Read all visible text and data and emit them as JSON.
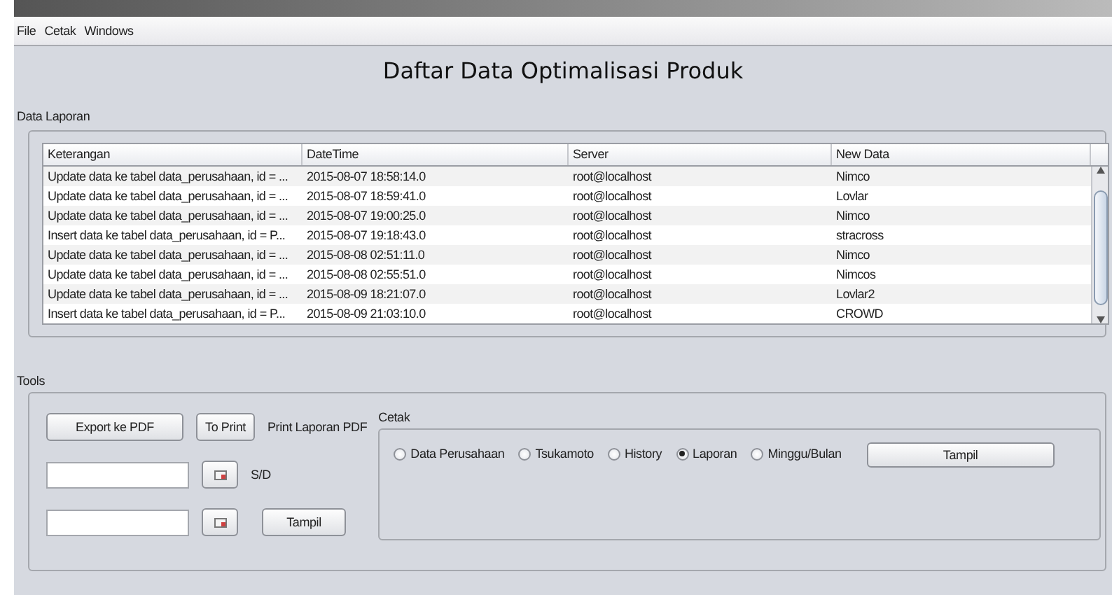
{
  "menu": [
    "File",
    "Cetak",
    "Windows"
  ],
  "title": "Daftar Data Optimalisasi Produk",
  "report_panel": {
    "label": "Data Laporan",
    "table": {
      "columns": [
        "Keterangan",
        "DateTime",
        "Server",
        "New Data"
      ],
      "rows": [
        [
          "Update data ke tabel data_perusahaan, id = ...",
          "2015-08-07 18:58:14.0",
          "root@localhost",
          "Nimco"
        ],
        [
          "Update data ke tabel data_perusahaan, id = ...",
          "2015-08-07 18:59:41.0",
          "root@localhost",
          "Lovlar"
        ],
        [
          "Update data ke tabel data_perusahaan, id = ...",
          "2015-08-07 19:00:25.0",
          "root@localhost",
          "Nimco"
        ],
        [
          "Insert data ke tabel data_perusahaan, id = P...",
          "2015-08-07 19:18:43.0",
          "root@localhost",
          "stracross"
        ],
        [
          "Update data ke tabel data_perusahaan, id = ...",
          "2015-08-08 02:51:11.0",
          "root@localhost",
          "Nimco"
        ],
        [
          "Update data ke tabel data_perusahaan, id = ...",
          "2015-08-08 02:55:51.0",
          "root@localhost",
          "Nimcos"
        ],
        [
          "Update data ke tabel data_perusahaan, id = ...",
          "2015-08-09 18:21:07.0",
          "root@localhost",
          "Lovlar2"
        ],
        [
          "Insert data ke tabel data_perusahaan, id = P...",
          "2015-08-09 21:03:10.0",
          "root@localhost",
          "CROWD"
        ]
      ]
    }
  },
  "tools_panel": {
    "label": "Tools",
    "export_button": "Export ke PDF",
    "print_button": "To Print",
    "print_label": "Print Laporan PDF",
    "range_label": "S/D",
    "show_button": "Tampil",
    "print_group": {
      "label": "Cetak",
      "options": [
        {
          "label": "Data Perusahaan",
          "selected": false
        },
        {
          "label": "Tsukamoto",
          "selected": false
        },
        {
          "label": "History",
          "selected": false
        },
        {
          "label": "Laporan",
          "selected": true
        },
        {
          "label": "Minggu/Bulan",
          "selected": false
        }
      ],
      "show_button": "Tampil"
    }
  }
}
